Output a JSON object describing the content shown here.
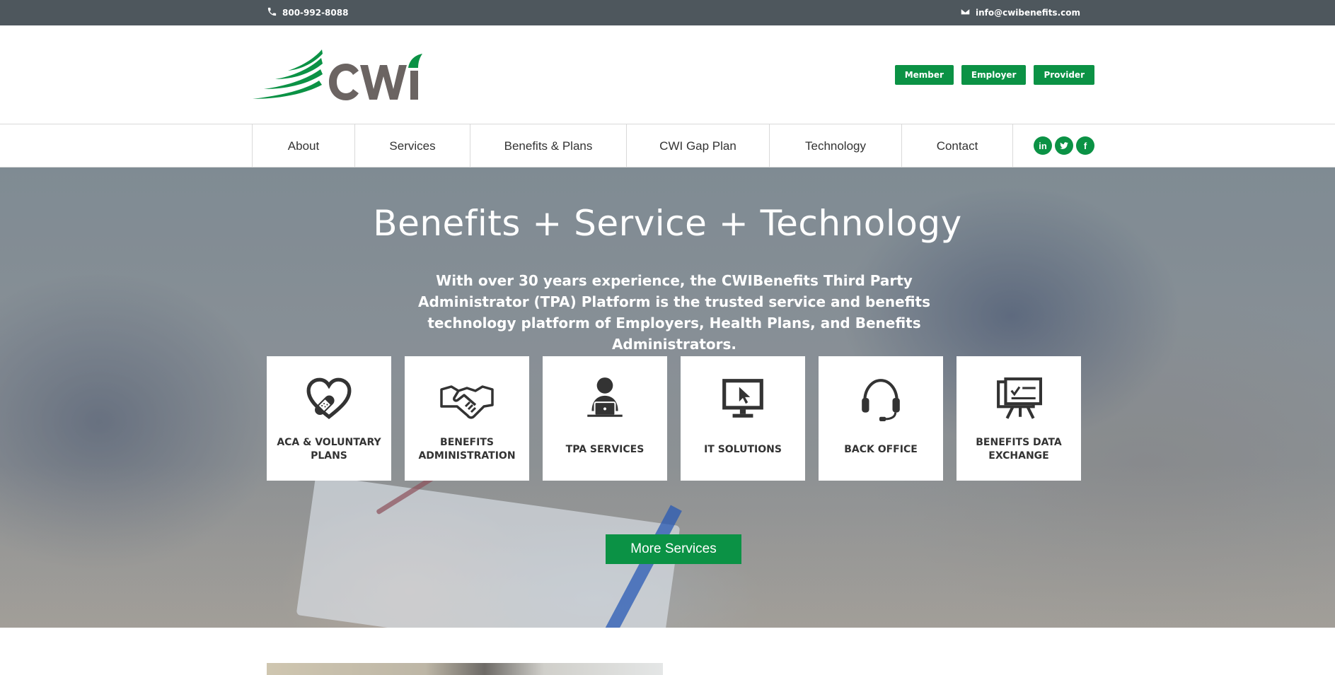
{
  "topbar": {
    "phone": "800-992-8088",
    "email": "info@cwibenefits.com"
  },
  "header": {
    "logo_text": "cwi",
    "portal_buttons": [
      "Member",
      "Employer",
      "Provider"
    ]
  },
  "nav": {
    "items": [
      "About",
      "Services",
      "Benefits & Plans",
      "CWI Gap Plan",
      "Technology",
      "Contact"
    ],
    "social": [
      "linkedin-icon",
      "twitter-icon",
      "facebook-icon"
    ]
  },
  "hero": {
    "title": "Benefits + Service + Technology",
    "subtitle": "With over 30 years experience, the CWIBenefits Third Party Administrator (TPA) Platform is the trusted service and benefits technology platform of Employers, Health Plans, and Benefits Administrators.",
    "cards": [
      {
        "label": "ACA & VOLUNTARY PLANS",
        "icon": "heart-bandage-icon"
      },
      {
        "label": "BENEFITS ADMINISTRATION",
        "icon": "handshake-icon"
      },
      {
        "label": "TPA SERVICES",
        "icon": "person-laptop-icon"
      },
      {
        "label": "IT SOLUTIONS",
        "icon": "monitor-cursor-icon"
      },
      {
        "label": "BACK OFFICE",
        "icon": "headset-icon"
      },
      {
        "label": "BENEFITS DATA EXCHANGE",
        "icon": "presentation-board-icon"
      }
    ],
    "more_button": "More Services"
  },
  "colors": {
    "brand_green": "#0b9245",
    "topbar_gray": "#4e575d",
    "logo_gray": "#6b6462"
  }
}
